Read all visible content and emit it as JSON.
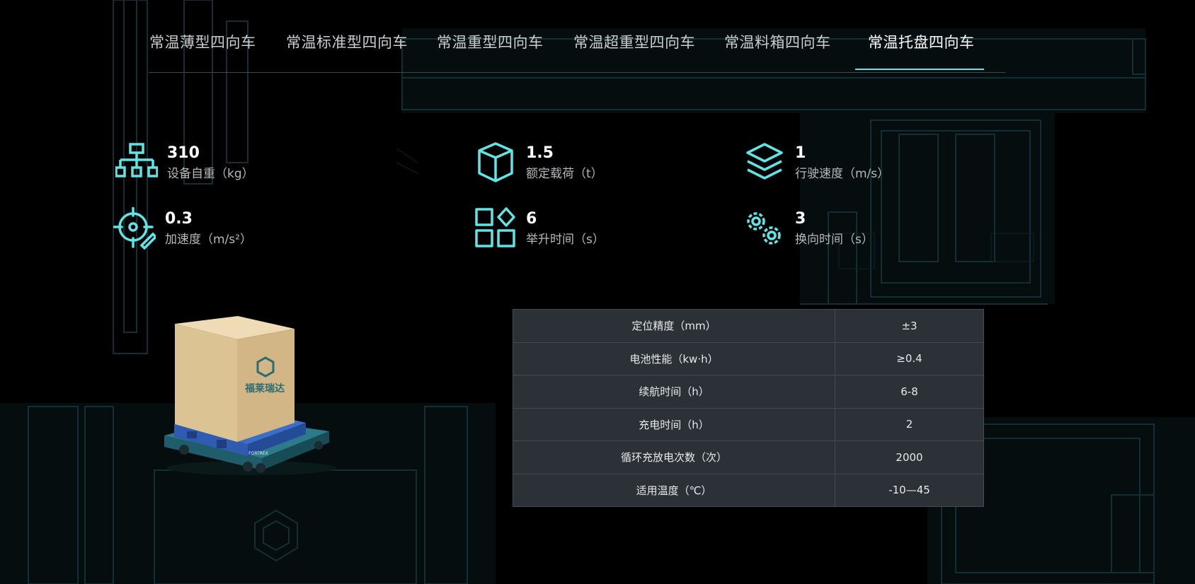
{
  "tabs": [
    {
      "label": "常温薄型四向车",
      "active": false
    },
    {
      "label": "常温标准型四向车",
      "active": false
    },
    {
      "label": "常温重型四向车",
      "active": false
    },
    {
      "label": "常温超重型四向车",
      "active": false
    },
    {
      "label": "常温料箱四向车",
      "active": false
    },
    {
      "label": "常温托盘四向车",
      "active": true
    }
  ],
  "specs": [
    {
      "value": "310",
      "label": "设备自重（kg）",
      "icon": "org-chart-icon"
    },
    {
      "value": "1.5",
      "label": "额定载荷（t）",
      "icon": "cube-icon"
    },
    {
      "value": "1",
      "label": "行驶速度（m/s）",
      "icon": "layers-icon"
    },
    {
      "value": "0.3",
      "label": "加速度（m/s²）",
      "icon": "target-edit-icon"
    },
    {
      "value": "6",
      "label": "举升时间（s）",
      "icon": "apps-grid-icon"
    },
    {
      "value": "3",
      "label": "换向时间（s）",
      "icon": "gears-icon"
    }
  ],
  "params": [
    {
      "name": "定位精度（mm）",
      "value": "±3"
    },
    {
      "name": "电池性能（kw·h）",
      "value": "≥0.4"
    },
    {
      "name": "续航时间（h）",
      "value": "6-8"
    },
    {
      "name": "充电时间（h）",
      "value": "2"
    },
    {
      "name": "循环充放电次数（次）",
      "value": "2000"
    },
    {
      "name": "适用温度（℃）",
      "value": "-10—45"
    }
  ],
  "product": {
    "box_brand": "福莱瑞达",
    "vehicle_brand": "FORTREX"
  },
  "colors": {
    "accent": "#5ee6e6",
    "table_bg": "#2b3136",
    "background": "#000000"
  }
}
